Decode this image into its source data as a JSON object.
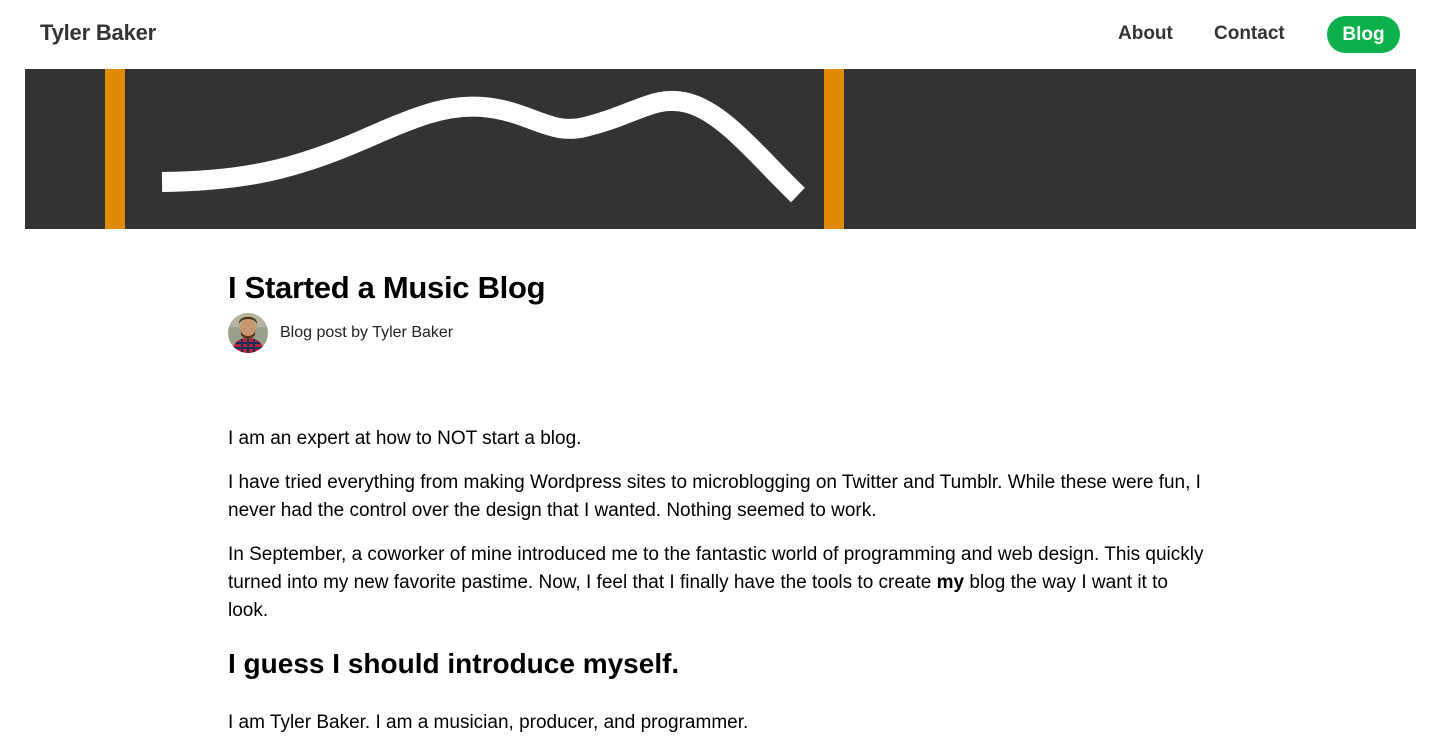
{
  "nav": {
    "brand": "Tyler Baker",
    "links": [
      "About",
      "Contact"
    ],
    "active": "Blog",
    "accent_color": "#0db14b"
  },
  "banner": {
    "background_color": "#333333",
    "stripe_color": "#e08a00",
    "wave_color": "#ffffff"
  },
  "post": {
    "title": "I Started a Music Blog",
    "byline": "Blog post by Tyler Baker",
    "avatar_icon": "author-avatar",
    "paragraphs": [
      "I am an expert at how to NOT start a blog.",
      "I have tried everything from making Wordpress sites to microblogging on Twitter and Tumblr. While these were fun, I never had the control over the design that I wanted. Nothing seemed to work."
    ],
    "p3": {
      "before": "In September, a coworker of mine introduced me to the fantastic world of programming and web design. This quickly turned into my new favorite pastime. Now, I feel that I finally have the tools to create ",
      "bold": "my",
      "after": " blog the way I want it to look."
    },
    "subheading": "I guess I should introduce myself.",
    "intro": "I am Tyler Baker. I am a musician, producer, and programmer."
  }
}
